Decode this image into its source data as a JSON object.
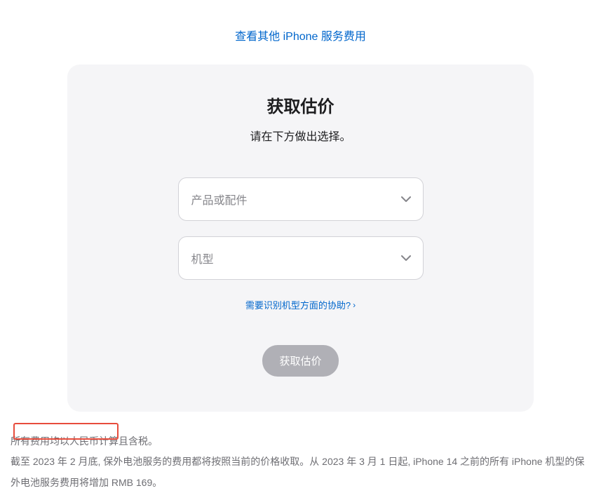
{
  "topLink": "查看其他 iPhone 服务费用",
  "card": {
    "title": "获取估价",
    "subtitle": "请在下方做出选择。",
    "select1Placeholder": "产品或配件",
    "select2Placeholder": "机型",
    "helpLink": "需要识别机型方面的协助?",
    "submitButton": "获取估价"
  },
  "footer": {
    "line1": "所有费用均以人民币计算且含税。",
    "line2": "截至 2023 年 2 月底, 保外电池服务的费用都将按照当前的价格收取。从 2023 年 3 月 1 日起, iPhone 14 之前的所有 iPhone 机型的保外电池服务费用将增加 RMB 169。"
  }
}
